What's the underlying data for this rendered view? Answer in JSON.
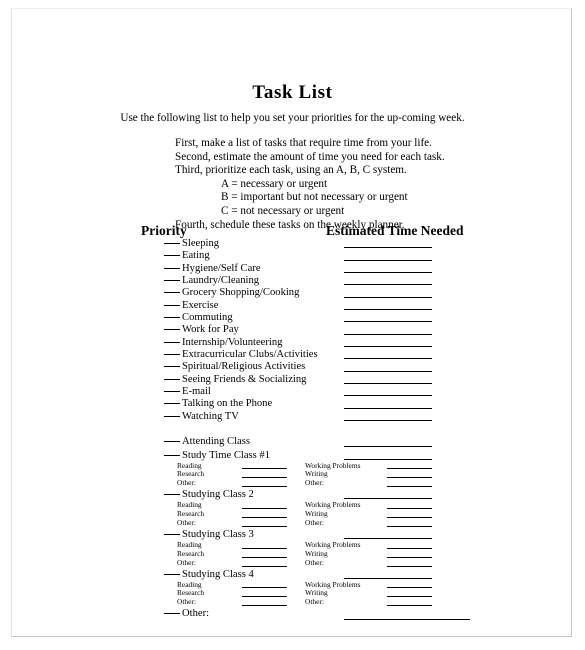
{
  "document": {
    "title": "Task List",
    "intro": "Use the following list to help you set your priorities for the up-coming week.",
    "steps": [
      "First, make a list of tasks that require time from your life.",
      "Second, estimate the amount of time you need for each task.",
      "Third, prioritize each task, using an A, B, C system."
    ],
    "priority_key": [
      "A = necessary or urgent",
      "B = important but not necessary or urgent",
      "C = not necessary or urgent"
    ],
    "final_step": "Fourth, schedule these tasks on the weekly planner.",
    "columns": {
      "priority": "Priority",
      "estimated_time": "Estimated Time Needed"
    },
    "tasks": [
      "Sleeping",
      "Eating",
      "Hygiene/Self Care",
      "Laundry/Cleaning",
      "Grocery Shopping/Cooking",
      "Exercise",
      "Commuting",
      "Work for Pay",
      "Internship/Volunteering",
      "Extracurricular Clubs/Activities",
      "Spiritual/Religious Activities",
      "Seeing Friends & Socializing",
      "E-mail",
      "Talking on the Phone",
      "Watching TV"
    ],
    "attending_class": "Attending Class",
    "study_blocks": [
      {
        "heading": "Study Time Class #1",
        "rows": [
          {
            "left": "Reading",
            "right": "Working Problems"
          },
          {
            "left": "Research",
            "right": "Writing"
          },
          {
            "left": "Other:",
            "right": "Other:"
          }
        ]
      },
      {
        "heading": "Studying Class 2",
        "rows": [
          {
            "left": "Reading",
            "right": "Working Problems"
          },
          {
            "left": "Research",
            "right": "Writing"
          },
          {
            "left": "Other:",
            "right": "Other:"
          }
        ]
      },
      {
        "heading": "Studying Class 3",
        "rows": [
          {
            "left": "Reading",
            "right": "Working Problems"
          },
          {
            "left": "Research",
            "right": "Writing"
          },
          {
            "left": "Other:",
            "right": "Other:"
          }
        ]
      },
      {
        "heading": "Studying Class 4",
        "rows": [
          {
            "left": "Reading",
            "right": "Working Problems"
          },
          {
            "left": "Research",
            "right": "Writing"
          },
          {
            "left": "Other:",
            "right": "Other:"
          }
        ]
      }
    ],
    "final_other": "Other:"
  }
}
